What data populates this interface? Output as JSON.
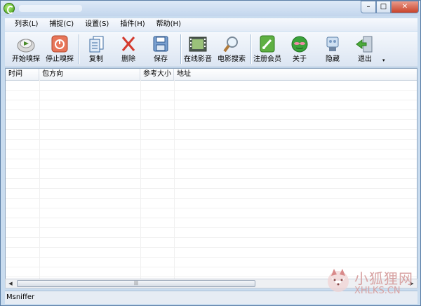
{
  "window": {
    "controls": {
      "minimize": "–",
      "maximize": "□",
      "close": "✕"
    }
  },
  "menu": [
    {
      "label": "列表(L)"
    },
    {
      "label": "捕捉(C)"
    },
    {
      "label": "设置(S)"
    },
    {
      "label": "插件(H)"
    },
    {
      "label": "帮助(H)"
    }
  ],
  "toolbar": {
    "buttons": [
      {
        "label": "开始嗅探",
        "icon": "start-sniff-icon"
      },
      {
        "label": "停止嗅探",
        "icon": "stop-sniff-icon"
      },
      {
        "label": "复制",
        "icon": "copy-icon"
      },
      {
        "label": "删除",
        "icon": "delete-icon"
      },
      {
        "label": "保存",
        "icon": "save-icon"
      },
      {
        "label": "在线影音",
        "icon": "film-icon"
      },
      {
        "label": "电影搜索",
        "icon": "magnifier-icon"
      },
      {
        "label": "注册会员",
        "icon": "register-icon"
      },
      {
        "label": "关于",
        "icon": "about-icon"
      },
      {
        "label": "隐藏",
        "icon": "hide-icon"
      },
      {
        "label": "退出",
        "icon": "exit-icon"
      }
    ],
    "more": "▾"
  },
  "list": {
    "columns": [
      "时间",
      "包方向",
      "参考大小",
      "地址"
    ],
    "rows": []
  },
  "scrollbar": {
    "left": "◀",
    "right": "▶",
    "grip": "|||"
  },
  "status": {
    "text": "Msniffer"
  },
  "watermark": {
    "cn": "小狐狸网",
    "en": "XHLKS.CN"
  },
  "colors": {
    "accent": "#c9dcef",
    "close": "#c9432a"
  }
}
